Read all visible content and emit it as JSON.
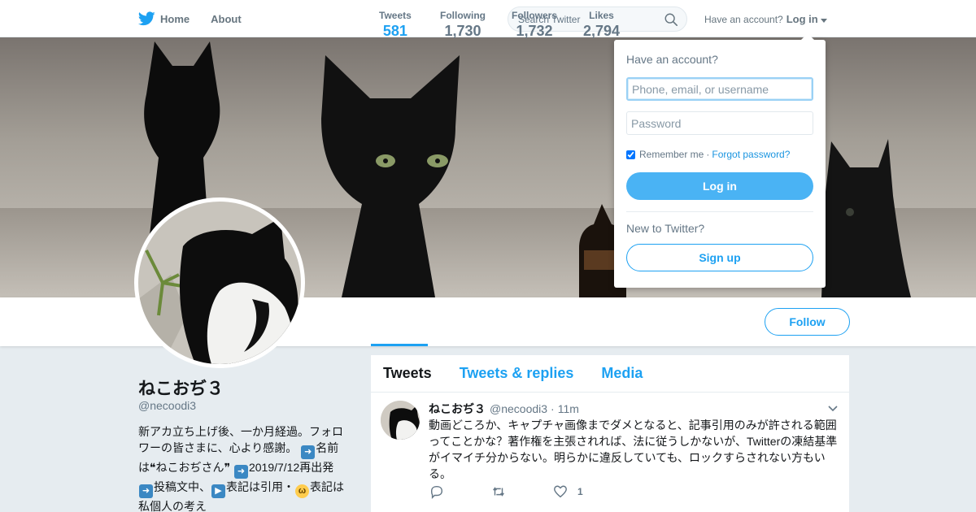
{
  "nav": {
    "home_label": "Home",
    "about_label": "About",
    "search_placeholder": "Search Twitter",
    "have_account": "Have an account?",
    "login_label": "Log in"
  },
  "profile": {
    "name": "ねこおぢ３",
    "handle": "@necoodi3",
    "bio_parts": [
      "新アカ立ち上げ後、一か月経過。フォロワーの皆さまに、心より感謝。",
      "名前は❝ねこおぢさん❞",
      "2019/7/12再出発",
      "投稿文中、",
      "表記は引用・",
      "表記は私個人の考え"
    ],
    "follow_label": "Follow"
  },
  "stats": [
    {
      "label": "Tweets",
      "value": "581"
    },
    {
      "label": "Following",
      "value": "1,730"
    },
    {
      "label": "Followers",
      "value": "1,732"
    },
    {
      "label": "Likes",
      "value": "2,794"
    }
  ],
  "timeline": {
    "tabs": [
      "Tweets",
      "Tweets & replies",
      "Media"
    ],
    "tweet": {
      "name": "ねこおぢ３",
      "handle": "@necoodi3",
      "dot": "·",
      "time": "11m",
      "text": "動画どころか、キャプチャ画像までダメとなると、記事引用のみが許される範囲ってことかな？著作権を主張されれば、法に従うしかないが、Twitterの凍結基準がイマイチ分からない。明らかに違反していても、ロックすらされない方もいる。",
      "like_count": "1"
    }
  },
  "login_dropdown": {
    "title": "Have an account?",
    "username_placeholder": "Phone, email, or username",
    "password_placeholder": "Password",
    "remember_label": "Remember me",
    "separator": "·",
    "forgot_label": "Forgot password?",
    "login_button": "Log in",
    "new_label": "New to Twitter?",
    "signup_button": "Sign up"
  },
  "colors": {
    "accent": "#1da1f2",
    "login_button": "#4ab3f4",
    "page_bg": "#e6ecf0"
  }
}
